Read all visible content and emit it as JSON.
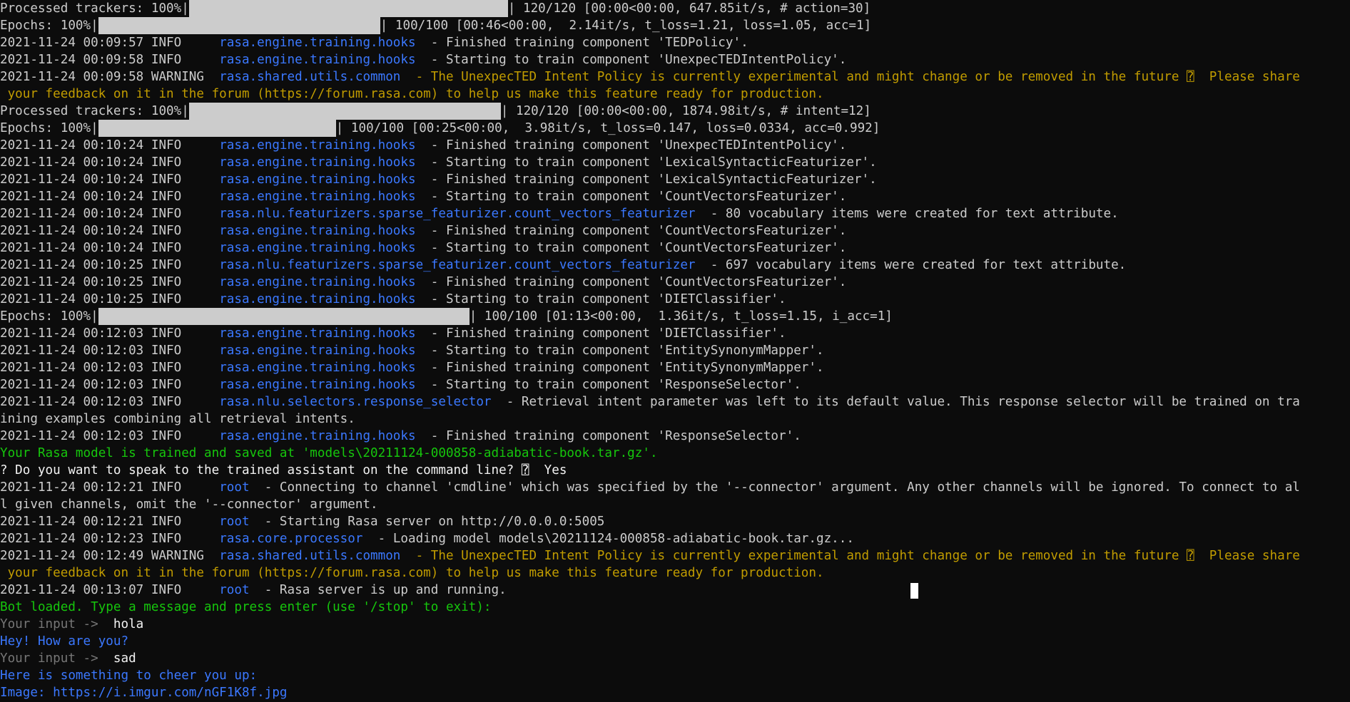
{
  "lines": [
    {
      "segs": [
        {
          "t": "Processed trackers: 100%|",
          "c": "gray"
        },
        {
          "bar": 0.86
        },
        {
          "t": "| 120/120 [00:00<00:00, 647.85it/s, # action=30]",
          "c": "gray"
        }
      ]
    },
    {
      "segs": [
        {
          "t": "Epochs: 100%|",
          "c": "gray"
        },
        {
          "bar": 0.76
        },
        {
          "t": "| 100/100 [00:46<00:00,  2.14it/s, t_loss=1.21, loss=1.05, acc=1]",
          "c": "gray"
        }
      ]
    },
    {
      "segs": [
        {
          "t": "2021-11-24 00:09:57 INFO     ",
          "c": "gray"
        },
        {
          "t": "rasa.engine.training.hooks",
          "c": "blue"
        },
        {
          "t": "  - Finished training component 'TEDPolicy'.",
          "c": "gray"
        }
      ]
    },
    {
      "segs": [
        {
          "t": "2021-11-24 00:09:58 INFO     ",
          "c": "gray"
        },
        {
          "t": "rasa.engine.training.hooks",
          "c": "blue"
        },
        {
          "t": "  - Starting to train component 'UnexpecTEDIntentPolicy'.",
          "c": "gray"
        }
      ]
    },
    {
      "segs": [
        {
          "t": "2021-11-24 00:09:58 WARNING  ",
          "c": "gray"
        },
        {
          "t": "rasa.shared.utils.common",
          "c": "blue"
        },
        {
          "t": "  - The UnexpecTED Intent Policy is currently experimental and might change or be removed in the future ⍰  Please share",
          "c": "yellow"
        }
      ]
    },
    {
      "segs": [
        {
          "t": " your feedback on it in the forum (https://forum.rasa.com) to help us make this feature ready for production.",
          "c": "yellow"
        }
      ]
    },
    {
      "segs": [
        {
          "t": "Processed trackers: 100%|",
          "c": "gray"
        },
        {
          "bar": 0.84
        },
        {
          "t": "| 120/120 [00:00<00:00, 1874.98it/s, # intent=12]",
          "c": "gray"
        }
      ]
    },
    {
      "segs": [
        {
          "t": "Epochs: 100%|",
          "c": "gray"
        },
        {
          "bar": 0.64
        },
        {
          "t": "| 100/100 [00:25<00:00,  3.98it/s, t_loss=0.147, loss=0.0334, acc=0.992]",
          "c": "gray"
        }
      ]
    },
    {
      "segs": [
        {
          "t": "2021-11-24 00:10:24 INFO     ",
          "c": "gray"
        },
        {
          "t": "rasa.engine.training.hooks",
          "c": "blue"
        },
        {
          "t": "  - Finished training component 'UnexpecTEDIntentPolicy'.",
          "c": "gray"
        }
      ]
    },
    {
      "segs": [
        {
          "t": "2021-11-24 00:10:24 INFO     ",
          "c": "gray"
        },
        {
          "t": "rasa.engine.training.hooks",
          "c": "blue"
        },
        {
          "t": "  - Starting to train component 'LexicalSyntacticFeaturizer'.",
          "c": "gray"
        }
      ]
    },
    {
      "segs": [
        {
          "t": "2021-11-24 00:10:24 INFO     ",
          "c": "gray"
        },
        {
          "t": "rasa.engine.training.hooks",
          "c": "blue"
        },
        {
          "t": "  - Finished training component 'LexicalSyntacticFeaturizer'.",
          "c": "gray"
        }
      ]
    },
    {
      "segs": [
        {
          "t": "2021-11-24 00:10:24 INFO     ",
          "c": "gray"
        },
        {
          "t": "rasa.engine.training.hooks",
          "c": "blue"
        },
        {
          "t": "  - Starting to train component 'CountVectorsFeaturizer'.",
          "c": "gray"
        }
      ]
    },
    {
      "segs": [
        {
          "t": "2021-11-24 00:10:24 INFO     ",
          "c": "gray"
        },
        {
          "t": "rasa.nlu.featurizers.sparse_featurizer.count_vectors_featurizer",
          "c": "blue"
        },
        {
          "t": "  - 80 vocabulary items were created for text attribute.",
          "c": "gray"
        }
      ]
    },
    {
      "segs": [
        {
          "t": "2021-11-24 00:10:24 INFO     ",
          "c": "gray"
        },
        {
          "t": "rasa.engine.training.hooks",
          "c": "blue"
        },
        {
          "t": "  - Finished training component 'CountVectorsFeaturizer'.",
          "c": "gray"
        }
      ]
    },
    {
      "segs": [
        {
          "t": "2021-11-24 00:10:24 INFO     ",
          "c": "gray"
        },
        {
          "t": "rasa.engine.training.hooks",
          "c": "blue"
        },
        {
          "t": "  - Starting to train component 'CountVectorsFeaturizer'.",
          "c": "gray"
        }
      ]
    },
    {
      "segs": [
        {
          "t": "2021-11-24 00:10:25 INFO     ",
          "c": "gray"
        },
        {
          "t": "rasa.nlu.featurizers.sparse_featurizer.count_vectors_featurizer",
          "c": "blue"
        },
        {
          "t": "  - 697 vocabulary items were created for text attribute.",
          "c": "gray"
        }
      ]
    },
    {
      "segs": [
        {
          "t": "2021-11-24 00:10:25 INFO     ",
          "c": "gray"
        },
        {
          "t": "rasa.engine.training.hooks",
          "c": "blue"
        },
        {
          "t": "  - Finished training component 'CountVectorsFeaturizer'.",
          "c": "gray"
        }
      ]
    },
    {
      "segs": [
        {
          "t": "2021-11-24 00:10:25 INFO     ",
          "c": "gray"
        },
        {
          "t": "rasa.engine.training.hooks",
          "c": "blue"
        },
        {
          "t": "  - Starting to train component 'DIETClassifier'.",
          "c": "gray"
        }
      ]
    },
    {
      "segs": [
        {
          "t": "Epochs: 100%|",
          "c": "gray"
        },
        {
          "bar": 1.0
        },
        {
          "t": "| 100/100 [01:13<00:00,  1.36it/s, t_loss=1.15, i_acc=1]",
          "c": "gray"
        }
      ]
    },
    {
      "segs": [
        {
          "t": "2021-11-24 00:12:03 INFO     ",
          "c": "gray"
        },
        {
          "t": "rasa.engine.training.hooks",
          "c": "blue"
        },
        {
          "t": "  - Finished training component 'DIETClassifier'.",
          "c": "gray"
        }
      ]
    },
    {
      "segs": [
        {
          "t": "2021-11-24 00:12:03 INFO     ",
          "c": "gray"
        },
        {
          "t": "rasa.engine.training.hooks",
          "c": "blue"
        },
        {
          "t": "  - Starting to train component 'EntitySynonymMapper'.",
          "c": "gray"
        }
      ]
    },
    {
      "segs": [
        {
          "t": "2021-11-24 00:12:03 INFO     ",
          "c": "gray"
        },
        {
          "t": "rasa.engine.training.hooks",
          "c": "blue"
        },
        {
          "t": "  - Finished training component 'EntitySynonymMapper'.",
          "c": "gray"
        }
      ]
    },
    {
      "segs": [
        {
          "t": "2021-11-24 00:12:03 INFO     ",
          "c": "gray"
        },
        {
          "t": "rasa.engine.training.hooks",
          "c": "blue"
        },
        {
          "t": "  - Starting to train component 'ResponseSelector'.",
          "c": "gray"
        }
      ]
    },
    {
      "segs": [
        {
          "t": "2021-11-24 00:12:03 INFO     ",
          "c": "gray"
        },
        {
          "t": "rasa.nlu.selectors.response_selector",
          "c": "blue"
        },
        {
          "t": "  - Retrieval intent parameter was left to its default value. This response selector will be trained on tra",
          "c": "gray"
        }
      ]
    },
    {
      "segs": [
        {
          "t": "ining examples combining all retrieval intents.",
          "c": "gray"
        }
      ]
    },
    {
      "segs": [
        {
          "t": "2021-11-24 00:12:03 INFO     ",
          "c": "gray"
        },
        {
          "t": "rasa.engine.training.hooks",
          "c": "blue"
        },
        {
          "t": "  - Finished training component 'ResponseSelector'.",
          "c": "gray"
        }
      ]
    },
    {
      "segs": [
        {
          "t": "Your Rasa model is trained and saved at 'models\\20211124-000858-adiabatic-book.tar.gz'.",
          "c": "green"
        }
      ]
    },
    {
      "segs": [
        {
          "t": "? Do you want to speak to the trained assistant on the command line? ⍰  Yes",
          "c": "white"
        }
      ]
    },
    {
      "segs": [
        {
          "t": "2021-11-24 00:12:21 INFO     ",
          "c": "gray"
        },
        {
          "t": "root",
          "c": "blue"
        },
        {
          "t": "  - Connecting to channel 'cmdline' which was specified by the '--connector' argument. Any other channels will be ignored. To connect to al",
          "c": "gray"
        }
      ]
    },
    {
      "segs": [
        {
          "t": "l given channels, omit the '--connector' argument.",
          "c": "gray"
        }
      ]
    },
    {
      "segs": [
        {
          "t": "2021-11-24 00:12:21 INFO     ",
          "c": "gray"
        },
        {
          "t": "root",
          "c": "blue"
        },
        {
          "t": "  - Starting Rasa server on http://0.0.0.0:5005",
          "c": "gray"
        }
      ]
    },
    {
      "segs": [
        {
          "t": "2021-11-24 00:12:23 INFO     ",
          "c": "gray"
        },
        {
          "t": "rasa.core.processor",
          "c": "blue"
        },
        {
          "t": "  - Loading model models\\20211124-000858-adiabatic-book.tar.gz...",
          "c": "gray"
        }
      ]
    },
    {
      "segs": [
        {
          "t": "2021-11-24 00:12:49 WARNING  ",
          "c": "gray"
        },
        {
          "t": "rasa.shared.utils.common",
          "c": "blue"
        },
        {
          "t": "  - The UnexpecTED Intent Policy is currently experimental and might change or be removed in the future ⍰  Please share",
          "c": "yellow"
        }
      ]
    },
    {
      "segs": [
        {
          "t": " your feedback on it in the forum (https://forum.rasa.com) to help us make this feature ready for production.",
          "c": "yellow"
        }
      ]
    },
    {
      "segs": [
        {
          "t": "2021-11-24 00:13:07 INFO     ",
          "c": "gray"
        },
        {
          "t": "root",
          "c": "blue"
        },
        {
          "t": "  - Rasa server is up and running.",
          "c": "gray"
        }
      ]
    },
    {
      "segs": [
        {
          "t": "Bot loaded. Type a message and press enter (use '/stop' to exit):",
          "c": "green"
        }
      ]
    },
    {
      "segs": [
        {
          "t": "Your input ->  ",
          "c": "input"
        },
        {
          "t": "hola",
          "c": "white"
        }
      ]
    },
    {
      "segs": [
        {
          "t": "Hey! How are you?",
          "c": "blue"
        }
      ]
    },
    {
      "segs": [
        {
          "t": "Your input ->  ",
          "c": "input"
        },
        {
          "t": "sad",
          "c": "white"
        }
      ]
    },
    {
      "segs": [
        {
          "t": "Here is something to cheer you up:",
          "c": "blue"
        }
      ]
    },
    {
      "segs": [
        {
          "t": "Image: https://i.imgur.com/nGF1K8f.jpg",
          "c": "blue"
        }
      ]
    }
  ]
}
